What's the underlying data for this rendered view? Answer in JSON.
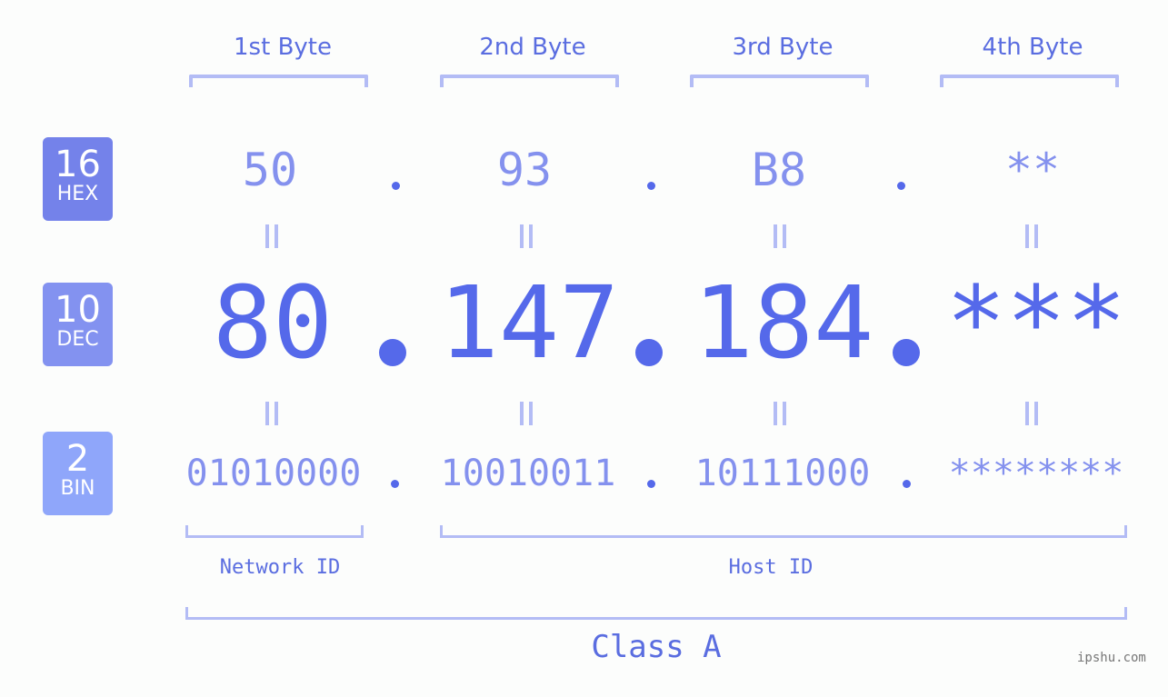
{
  "bytes": [
    {
      "label": "1st Byte",
      "hex": "50",
      "dec": "80",
      "bin": "01010000"
    },
    {
      "label": "2nd Byte",
      "hex": "93",
      "dec": "147",
      "bin": "10010011"
    },
    {
      "label": "3rd Byte",
      "hex": "B8",
      "dec": "184",
      "bin": "10111000"
    },
    {
      "label": "4th Byte",
      "hex": "**",
      "dec": "***",
      "bin": "********"
    }
  ],
  "badges": {
    "hex": {
      "num": "16",
      "label": "HEX",
      "color": "#7482ea"
    },
    "dec": {
      "num": "10",
      "label": "DEC",
      "color": "#8392f0"
    },
    "bin": {
      "num": "2",
      "label": "BIN",
      "color": "#8fa6fa"
    }
  },
  "segments": {
    "network": "Network ID",
    "host": "Host ID"
  },
  "ip_class": "Class A",
  "watermark": "ipshu.com",
  "colors": {
    "accent": "#5569ea",
    "light": "#8491ee",
    "bracket": "#b3bcf5"
  }
}
